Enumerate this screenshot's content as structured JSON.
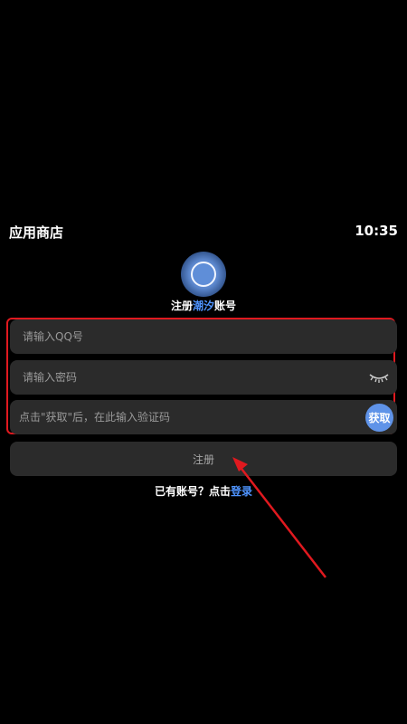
{
  "status_bar": {
    "app_name": "应用商店",
    "time": "10:35"
  },
  "header": {
    "title_prefix": "注册",
    "title_brand": "潮汐",
    "title_suffix": "账号"
  },
  "form": {
    "qq_placeholder": "请输入QQ号",
    "password_placeholder": "请输入密码",
    "code_placeholder": "点击\"获取\"后，在此输入验证码",
    "get_code_label": "获取",
    "register_label": "注册"
  },
  "footer": {
    "have_account_text": "已有账号？点击",
    "login_link": "登录"
  },
  "colors": {
    "accent": "#4f94ff",
    "highlight_box": "#e0191f",
    "field_bg": "#2b2b2b",
    "get_button": "#5f93e8"
  },
  "icons": {
    "password_toggle": "eye-closed-icon",
    "logo": "tide-logo-icon"
  }
}
